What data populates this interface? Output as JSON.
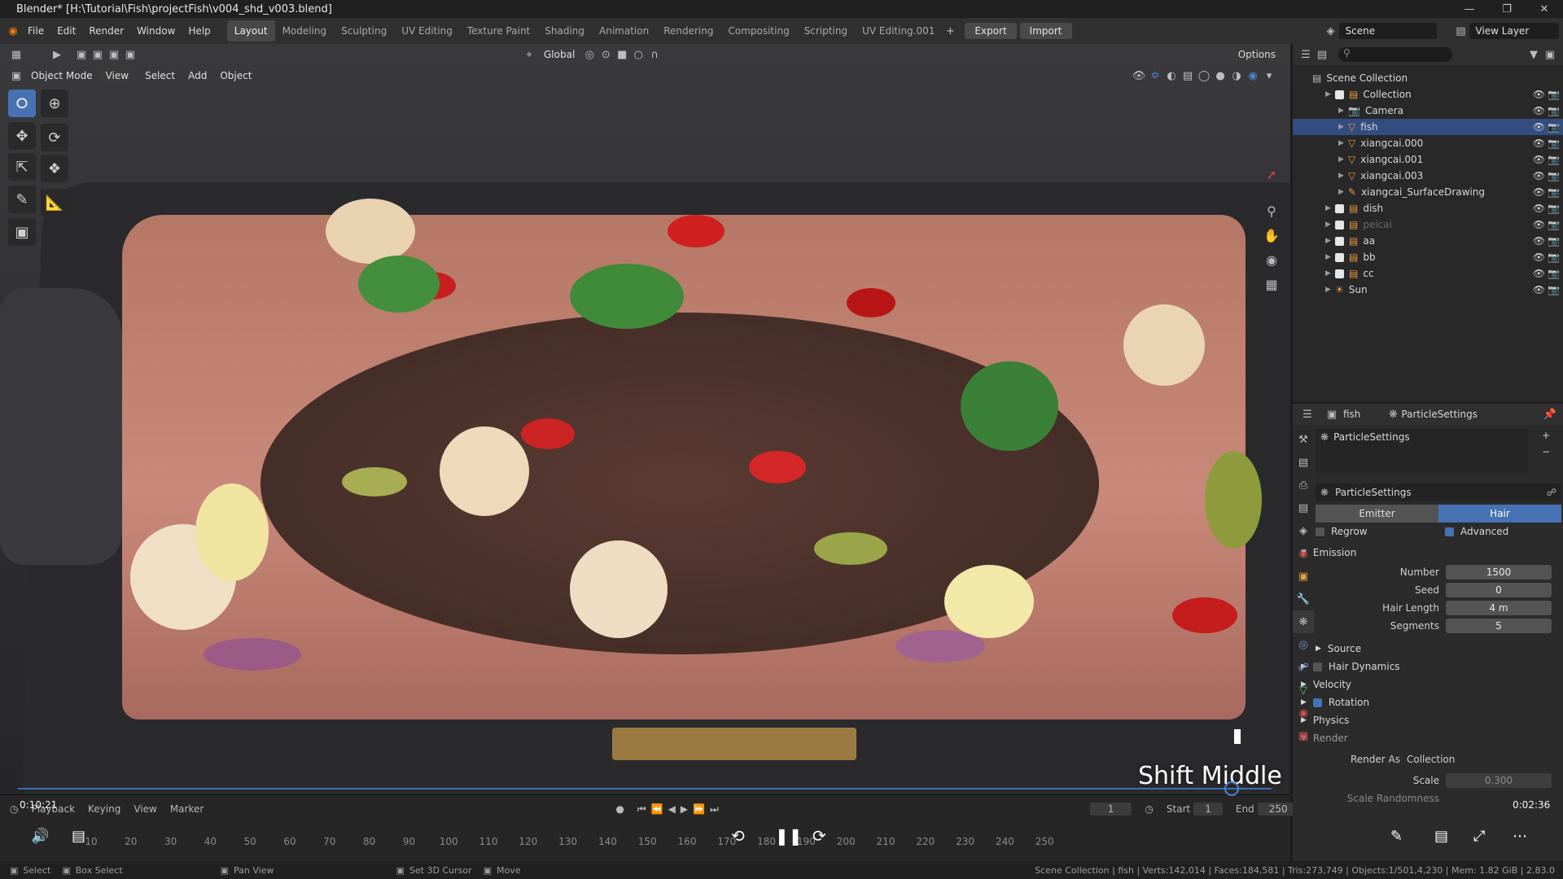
{
  "title": "Blender* [H:\\Tutorial\\Fish\\projectFish\\v004_shd_v003.blend]",
  "menu": [
    "File",
    "Edit",
    "Render",
    "Window",
    "Help"
  ],
  "workspaces": [
    {
      "label": "Layout",
      "active": true
    },
    {
      "label": "Modeling"
    },
    {
      "label": "Sculpting"
    },
    {
      "label": "UV Editing"
    },
    {
      "label": "Texture Paint"
    },
    {
      "label": "Shading"
    },
    {
      "label": "Animation"
    },
    {
      "label": "Rendering"
    },
    {
      "label": "Compositing"
    },
    {
      "label": "Scripting"
    },
    {
      "label": "UV Editing.001"
    }
  ],
  "export_label": "Export",
  "import_label": "Import",
  "scene": "Scene",
  "view_layer": "View Layer",
  "viewport": {
    "mode": "Object Mode",
    "menus": [
      "View",
      "Select",
      "Add",
      "Object"
    ],
    "orientation": "Global",
    "options": "Options"
  },
  "outliner": {
    "root": "Scene Collection",
    "items": [
      {
        "label": "Collection",
        "indent": 1
      },
      {
        "label": "Camera",
        "indent": 2
      },
      {
        "label": "fish",
        "indent": 2,
        "selected": true
      },
      {
        "label": "xiangcai.000",
        "indent": 2
      },
      {
        "label": "xiangcai.001",
        "indent": 2
      },
      {
        "label": "xiangcai.003",
        "indent": 2
      },
      {
        "label": "xiangcai_SurfaceDrawing",
        "indent": 2
      },
      {
        "label": "dish",
        "indent": 1
      },
      {
        "label": "peicai",
        "indent": 1,
        "dim": true
      },
      {
        "label": "aa",
        "indent": 1
      },
      {
        "label": "bb",
        "indent": 1
      },
      {
        "label": "cc",
        "indent": 1
      },
      {
        "label": "Sun",
        "indent": 1
      }
    ]
  },
  "properties": {
    "object": "fish",
    "context": "ParticleSettings",
    "slot": "ParticleSettings",
    "settings_name": "ParticleSettings",
    "type_emitter": "Emitter",
    "type_hair": "Hair",
    "regrow": "Regrow",
    "advanced": "Advanced",
    "emission": "Emission",
    "number_label": "Number",
    "number": "1500",
    "seed_label": "Seed",
    "seed": "0",
    "hairlen_label": "Hair Length",
    "hairlen": "4 m",
    "segments_label": "Segments",
    "segments": "5",
    "source": "Source",
    "hair_dynamics": "Hair Dynamics",
    "velocity": "Velocity",
    "rotation": "Rotation",
    "physics": "Physics",
    "render": "Render",
    "render_as_label": "Render As",
    "render_as": "Collection",
    "scale_label": "Scale",
    "scale": "0.300",
    "scale_rand_label": "Scale Randomness"
  },
  "timeline": {
    "menus": [
      "Playback",
      "Keying",
      "View",
      "Marker"
    ],
    "frame": "1",
    "start_label": "Start",
    "start": "1",
    "end_label": "End",
    "end": "250",
    "ticks": [
      "10",
      "20",
      "30",
      "40",
      "50",
      "60",
      "70",
      "80",
      "90",
      "100",
      "110",
      "120",
      "130",
      "140",
      "150",
      "160",
      "170",
      "180",
      "190",
      "200",
      "210",
      "220",
      "230",
      "240",
      "250"
    ]
  },
  "video": {
    "elapsed": "0:10:21",
    "remaining": "0:02:36",
    "overlay_text": "Shift Middle",
    "progress": 0.968
  },
  "status": {
    "select": "Select",
    "box_select": "Box Select",
    "pan_view": "Pan View",
    "set_cursor": "Set 3D Cursor",
    "move": "Move",
    "right": "Scene Collection | fish | Verts:142,014 | Faces:184,581 | Tris:273,749 | Objects:1/501,4,230 | Mem: 1.82 GiB | 2.83.0"
  },
  "colors": {
    "accent": "#4772b3",
    "selected_row": "#334d80"
  }
}
